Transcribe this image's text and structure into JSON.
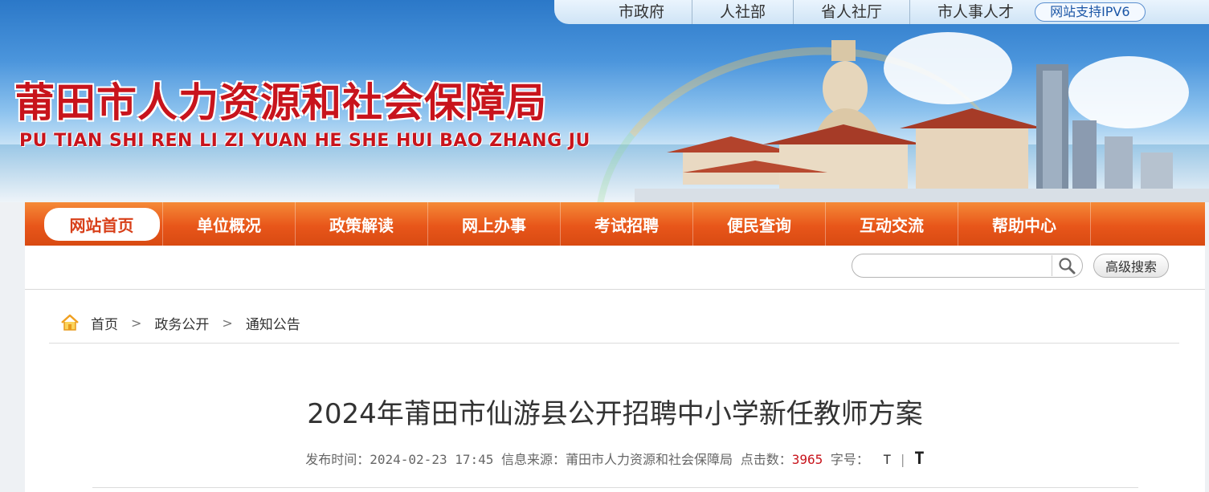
{
  "top_links": {
    "city_gov": "市政府",
    "hrss": "人社部",
    "prov_hrss": "省人社厅",
    "city_talent": "市人事人才",
    "ipv6": "网站支持IPV6"
  },
  "site": {
    "title": "莆田市人力资源和社会保障局",
    "pinyin": "PU TIAN SHI REN LI ZI YUAN HE SHE HUI BAO ZHANG JU"
  },
  "nav": {
    "home": "网站首页",
    "overview": "单位概况",
    "policy": "政策解读",
    "online": "网上办事",
    "exam": "考试招聘",
    "query": "便民查询",
    "interact": "互动交流",
    "help": "帮助中心"
  },
  "search": {
    "placeholder": "",
    "advanced": "高级搜索"
  },
  "breadcrumb": {
    "home": "首页",
    "public": "政务公开",
    "notice": "通知公告",
    "separator": ">"
  },
  "article": {
    "title": "2024年莆田市仙游县公开招聘中小学新任教师方案",
    "publish_label": "发布时间：",
    "publish_time": "2024-02-23 17:45",
    "source_label": "信息来源：",
    "source": "莆田市人力资源和社会保障局",
    "clicks_label": "点击数：",
    "clicks": "3965",
    "font_label": "字号：",
    "font_small": "T",
    "font_sep": "|",
    "font_large": "T"
  },
  "colors": {
    "brand_red": "#c8141c",
    "nav_orange": "#e8561a"
  }
}
